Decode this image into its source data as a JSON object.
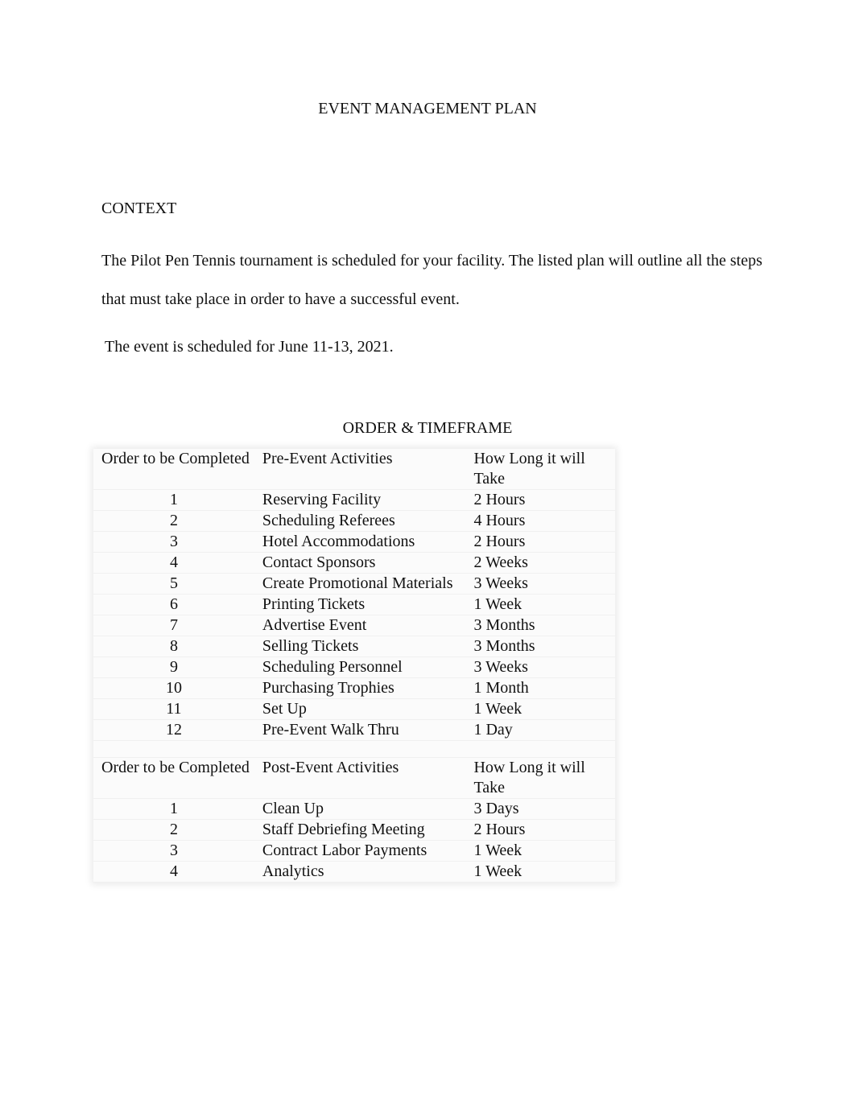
{
  "document": {
    "title": "EVENT MANAGEMENT PLAN",
    "section_heading": "CONTEXT",
    "paragraph": "The Pilot Pen Tennis tournament is scheduled for your facility. The listed plan will outline all the steps that must take place in order to have a successful event.",
    "date_line": "The event is scheduled for June 11-13, 2021.",
    "table_title": "ORDER & TIMEFRAME"
  },
  "pre_event": {
    "headers": [
      "Order to be Completed",
      "Pre-Event Activities",
      "How Long it will Take"
    ],
    "rows": [
      {
        "order": "1",
        "activity": "Reserving Facility",
        "duration": "2 Hours"
      },
      {
        "order": "2",
        "activity": "Scheduling Referees",
        "duration": "4 Hours"
      },
      {
        "order": "3",
        "activity": "Hotel Accommodations",
        "duration": "2 Hours"
      },
      {
        "order": "4",
        "activity": "Contact Sponsors",
        "duration": "2 Weeks"
      },
      {
        "order": "5",
        "activity": "Create Promotional Materials",
        "duration": "3 Weeks"
      },
      {
        "order": "6",
        "activity": "Printing Tickets",
        "duration": "1 Week"
      },
      {
        "order": "7",
        "activity": "Advertise Event",
        "duration": "3 Months"
      },
      {
        "order": "8",
        "activity": "Selling Tickets",
        "duration": "3 Months"
      },
      {
        "order": "9",
        "activity": "Scheduling Personnel",
        "duration": "3 Weeks"
      },
      {
        "order": "10",
        "activity": "Purchasing Trophies",
        "duration": "1 Month"
      },
      {
        "order": "11",
        "activity": "Set Up",
        "duration": "1 Week"
      },
      {
        "order": "12",
        "activity": "Pre-Event Walk Thru",
        "duration": "1 Day"
      }
    ]
  },
  "post_event": {
    "headers": [
      "Order to be Completed",
      "Post-Event Activities",
      "How Long it will Take"
    ],
    "rows": [
      {
        "order": "1",
        "activity": "Clean Up",
        "duration": "3 Days"
      },
      {
        "order": "2",
        "activity": "Staff Debriefing Meeting",
        "duration": "2 Hours"
      },
      {
        "order": "3",
        "activity": "Contract Labor Payments",
        "duration": "1 Week"
      },
      {
        "order": "4",
        "activity": "Analytics",
        "duration": "1 Week"
      }
    ]
  }
}
